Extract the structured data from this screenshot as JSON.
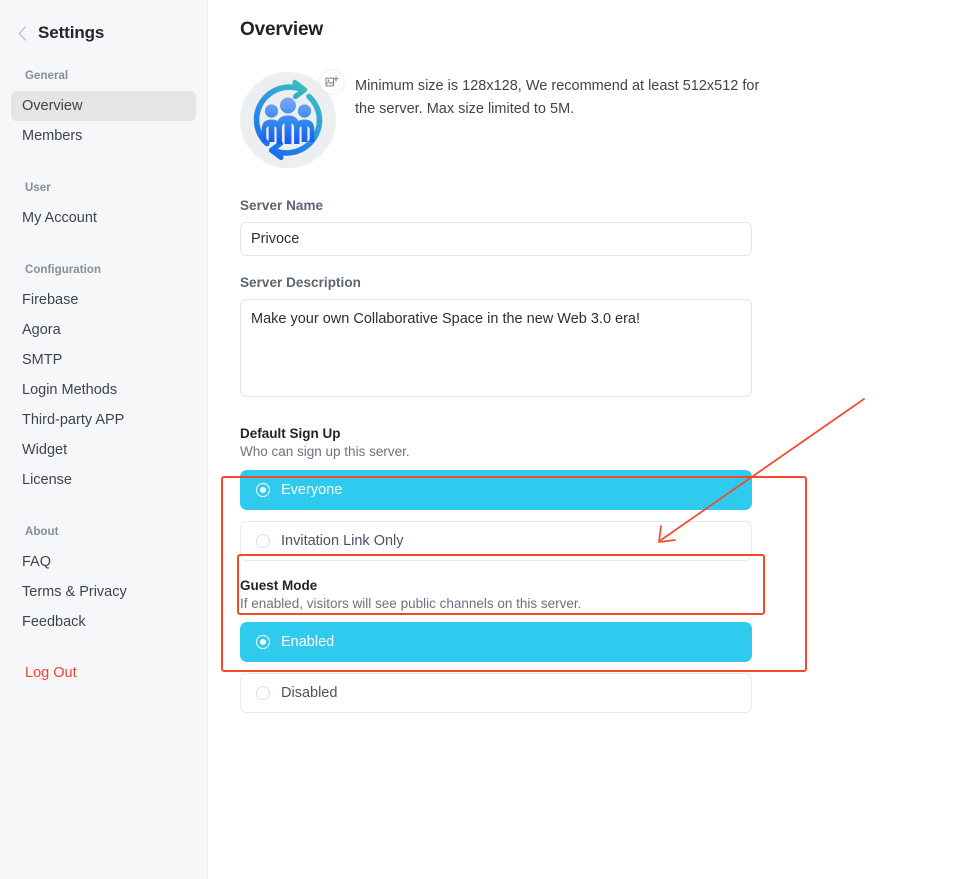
{
  "sidebar": {
    "back_icon": "chevron-left-icon",
    "title": "Settings",
    "groups": [
      {
        "label": "General",
        "items": [
          {
            "label": "Overview",
            "active": true
          },
          {
            "label": "Members",
            "active": false
          }
        ]
      },
      {
        "label": "User",
        "items": [
          {
            "label": "My Account",
            "active": false
          }
        ]
      },
      {
        "label": "Configuration",
        "items": [
          {
            "label": "Firebase",
            "active": false
          },
          {
            "label": "Agora",
            "active": false
          },
          {
            "label": "SMTP",
            "active": false
          },
          {
            "label": "Login Methods",
            "active": false
          },
          {
            "label": "Third-party APP",
            "active": false
          },
          {
            "label": "Widget",
            "active": false
          },
          {
            "label": "License",
            "active": false
          }
        ]
      },
      {
        "label": "About",
        "items": [
          {
            "label": "FAQ",
            "active": false
          },
          {
            "label": "Terms & Privacy",
            "active": false
          },
          {
            "label": "Feedback",
            "active": false
          }
        ]
      }
    ],
    "logout_label": "Log Out",
    "logout_color": "#f04235"
  },
  "main": {
    "page_title": "Overview",
    "avatar": {
      "icon": "server-logo-people-cycle",
      "badge_icon": "add-image-icon",
      "hint": "Minimum size is 128x128, We recommend at least 512x512 for the server. Max size limited to 5M."
    },
    "server_name": {
      "label": "Server Name",
      "value": "Privoce",
      "placeholder": "Server Name"
    },
    "server_description": {
      "label": "Server Description",
      "value": "Make your own Collaborative Space in the new Web 3.0 era!",
      "placeholder": "Server Description"
    },
    "default_sign_up": {
      "title": "Default Sign Up",
      "subtitle": "Who can sign up this server.",
      "options": [
        {
          "label": "Everyone",
          "selected": true
        },
        {
          "label": "Invitation Link Only",
          "selected": false
        }
      ]
    },
    "guest_mode": {
      "title": "Guest Mode",
      "subtitle": "If enabled, visitors will see public channels on this server.",
      "options": [
        {
          "label": "Enabled",
          "selected": true
        },
        {
          "label": "Disabled",
          "selected": false
        }
      ]
    }
  },
  "theme": {
    "accent": "#2ecbef",
    "annotation_red": "#f6492a",
    "sidebar_bg": "#f6f7f9",
    "active_item_bg": "#e6e5e3"
  },
  "annotations": {
    "outer_box_target": "default-sign-up-section",
    "inner_box_target": "signup-option-everyone",
    "arrow": "points-to-default-sign-up-section"
  }
}
